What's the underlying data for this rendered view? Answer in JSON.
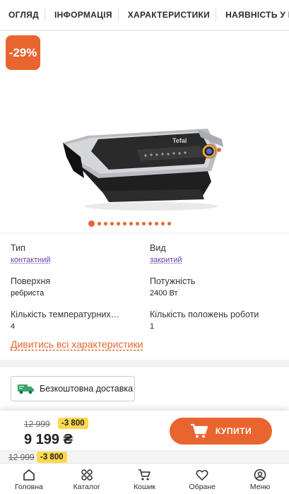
{
  "tabs": [
    "ОГЛЯД",
    "ІНФОРМАЦІЯ",
    "ХАРАКТЕРИСТИКИ",
    "НАЯВНІСТЬ У МАГАЗИНАХ"
  ],
  "product": {
    "discount_badge": "-29%",
    "brand_on_device": "Tefal",
    "gallery_dots": 13,
    "gallery_active_index": 0
  },
  "specs": [
    {
      "label": "Тип",
      "value": "контактний",
      "link": true
    },
    {
      "label": "Вид",
      "value": "закритий",
      "link": true
    },
    {
      "label": "Поверхня",
      "value": "ребриста",
      "link": false
    },
    {
      "label": "Потужність",
      "value": "2400 Вт",
      "link": false
    },
    {
      "label": "Кількість температурних…",
      "value": "4",
      "link": false
    },
    {
      "label": "Кількість положень роботи",
      "value": "1",
      "link": false
    }
  ],
  "all_specs_link": "Дивитись всі характеристики",
  "delivery": {
    "label": "Безкоштовна доставка",
    "icon": "truck-icon"
  },
  "buy_bar": {
    "old_price": "12 999",
    "discount": "-3 800",
    "new_price": "9 199 ₴",
    "buy_label": "КУПИТИ"
  },
  "ghost_bar": {
    "old_price": "12 999",
    "discount": "-3 800"
  },
  "bottom_nav": [
    {
      "label": "Головна",
      "icon": "home-icon"
    },
    {
      "label": "Каталог",
      "icon": "grid-icon"
    },
    {
      "label": "Кошик",
      "icon": "cart-icon"
    },
    {
      "label": "Обране",
      "icon": "heart-icon"
    },
    {
      "label": "Меню",
      "icon": "user-icon"
    }
  ],
  "colors": {
    "accent": "#e8652f",
    "badge_yellow": "#ffd84d",
    "link_purple": "#6a3da8"
  }
}
